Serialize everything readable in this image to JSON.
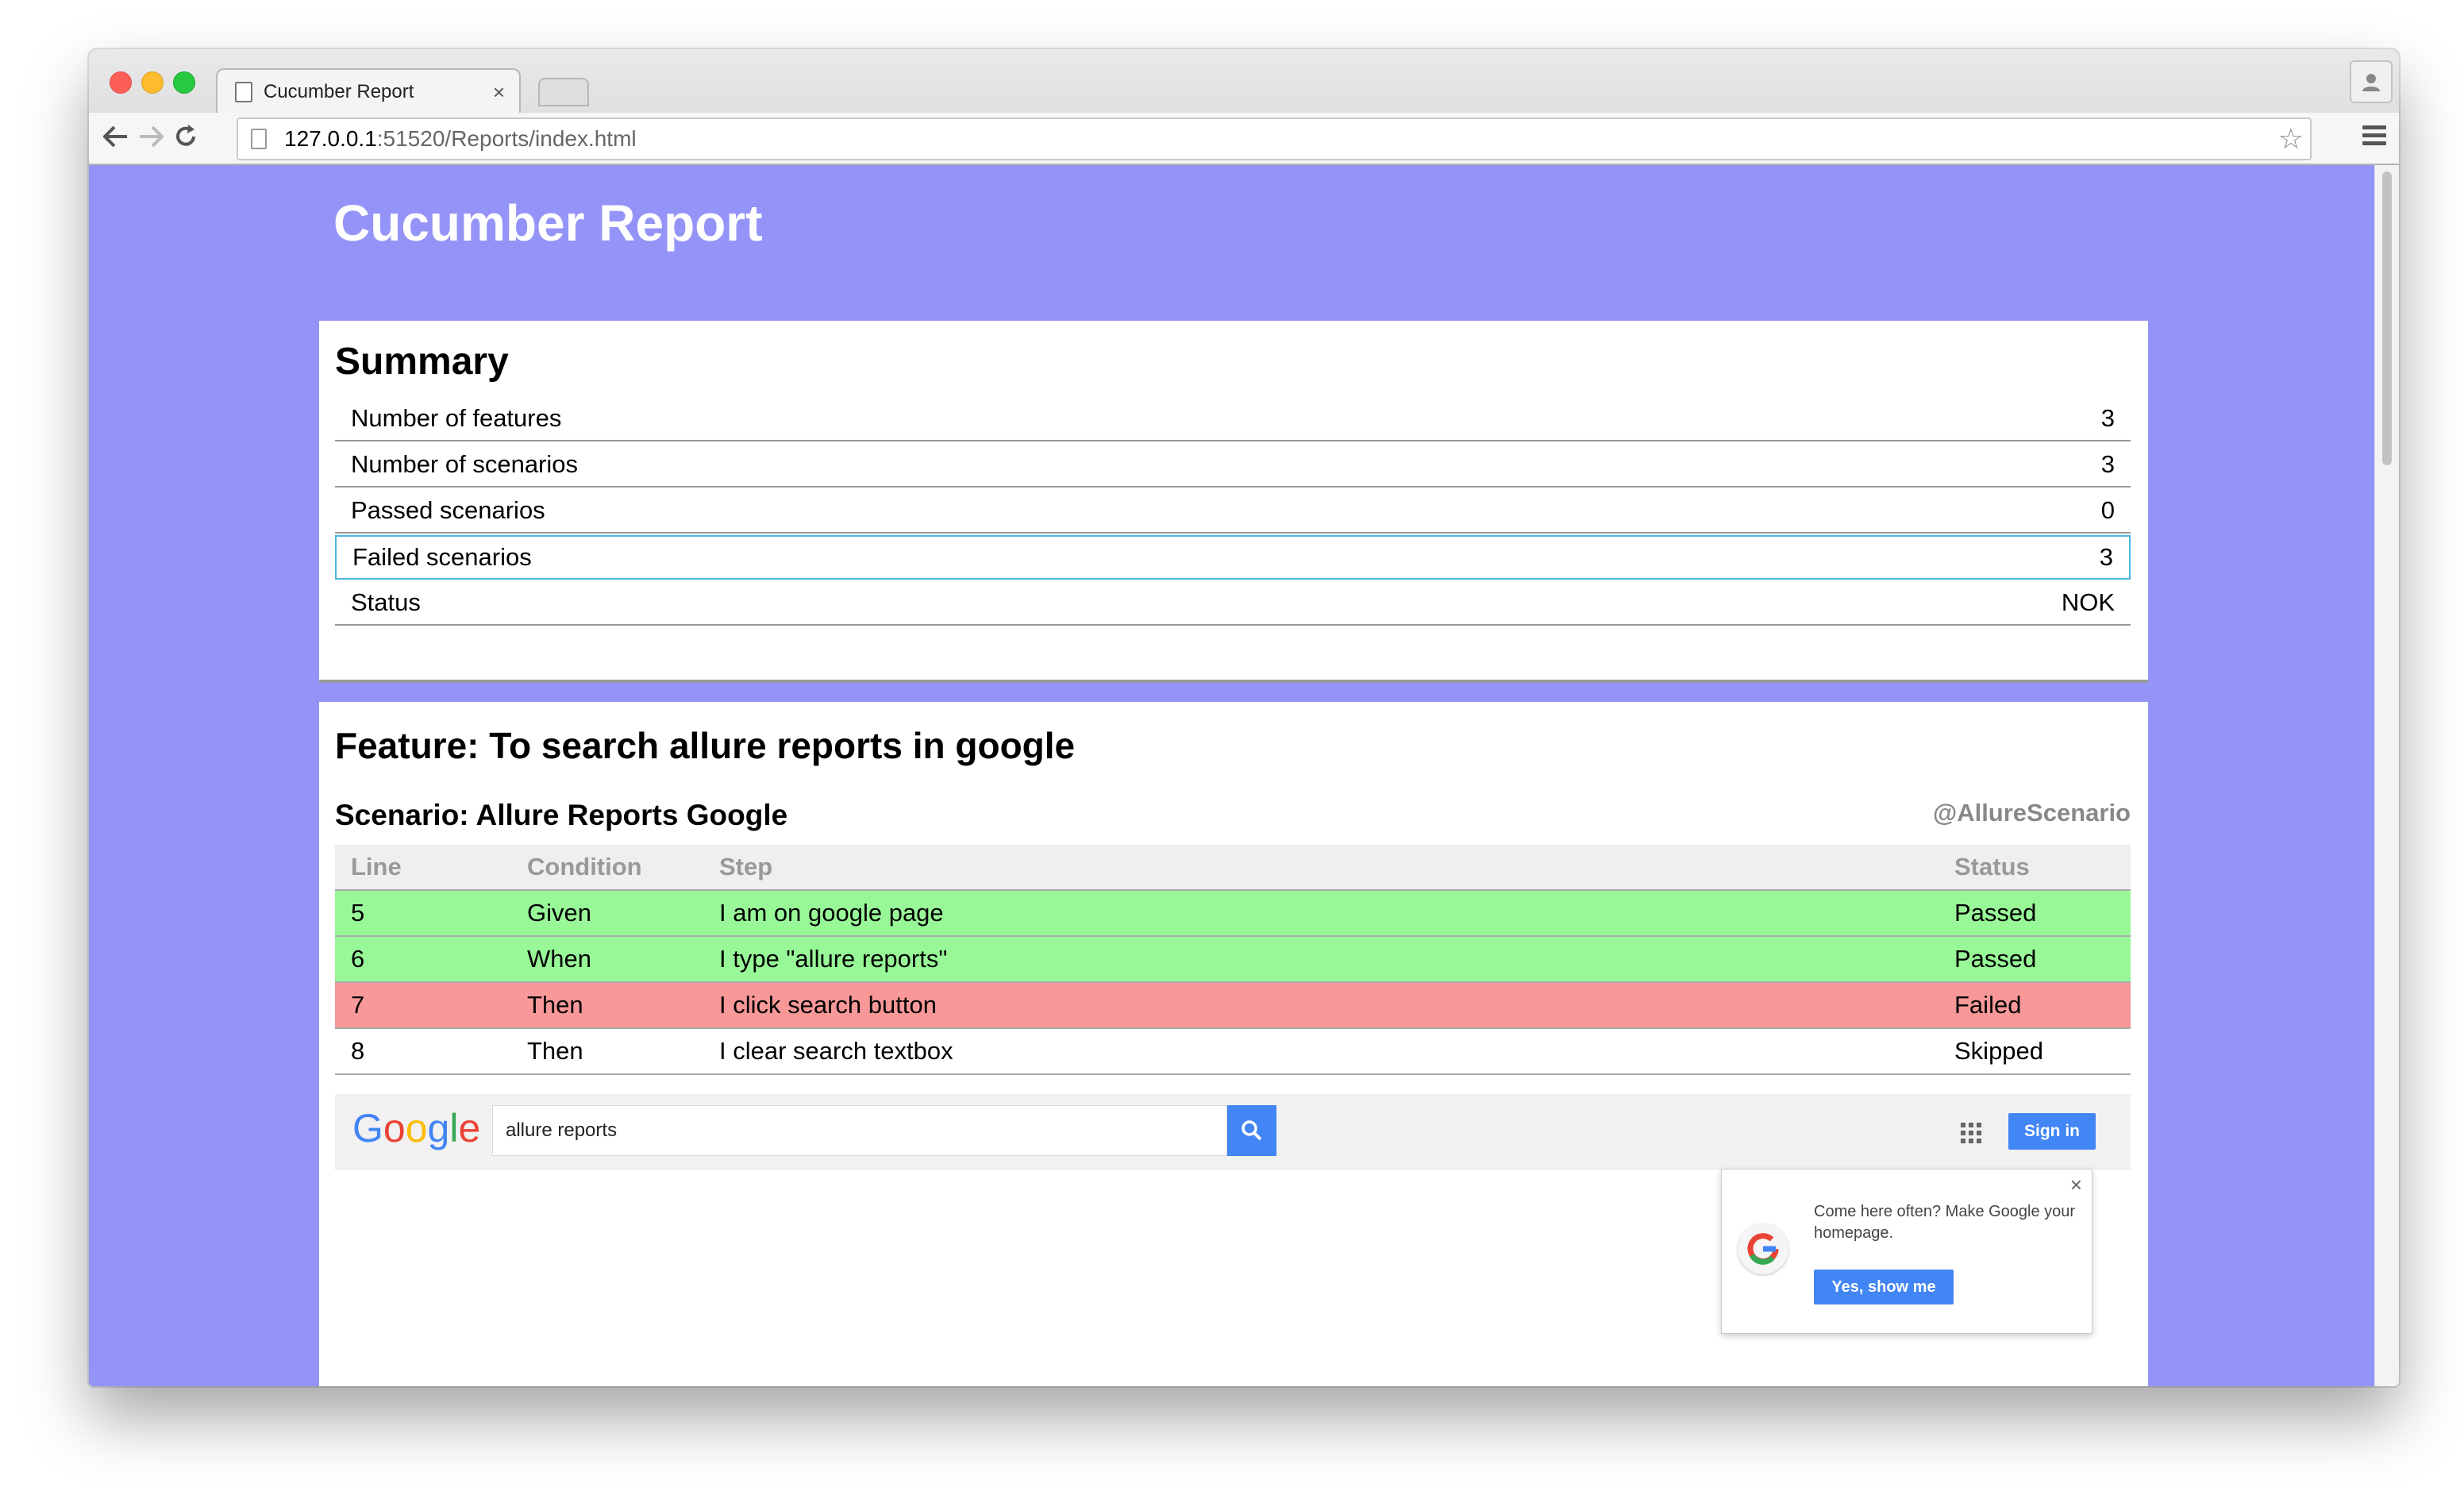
{
  "browser": {
    "tab_title": "Cucumber Report",
    "tab_close": "×",
    "url_host": "127.0.0.1",
    "url_rest": ":51520/Reports/index.html",
    "star_icon": "☆"
  },
  "page": {
    "title": "Cucumber Report",
    "background_color": "#9494f8"
  },
  "summary": {
    "title": "Summary",
    "rows": [
      {
        "label": "Number of features",
        "value": "3"
      },
      {
        "label": "Number of scenarios",
        "value": "3"
      },
      {
        "label": "Passed scenarios",
        "value": "0"
      },
      {
        "label": "Failed scenarios",
        "value": "3"
      },
      {
        "label": "Status",
        "value": "NOK"
      }
    ]
  },
  "feature": {
    "title": "Feature: To search allure reports in google",
    "scenario": {
      "title": "Scenario: Allure Reports Google",
      "tag": "@AllureScenario",
      "headers": {
        "line": "Line",
        "condition": "Condition",
        "step": "Step",
        "status": "Status"
      },
      "steps": [
        {
          "line": "5",
          "condition": "Given",
          "step": "I am on google page",
          "status": "Passed"
        },
        {
          "line": "6",
          "condition": "When",
          "step": "I type \"allure reports\"",
          "status": "Passed"
        },
        {
          "line": "7",
          "condition": "Then",
          "step": "I click search button",
          "status": "Failed"
        },
        {
          "line": "8",
          "condition": "Then",
          "step": "I clear search textbox",
          "status": "Skipped"
        }
      ],
      "status_colors": {
        "Passed": "#98f898",
        "Failed": "#f89898",
        "Skipped": "#ffffff"
      }
    }
  },
  "screenshot": {
    "logo": "Google",
    "search_value": "allure reports",
    "sign_in": "Sign in",
    "promo_close": "×",
    "promo_text": "Come here often? Make Google your homepage.",
    "promo_button": "Yes, show me"
  }
}
